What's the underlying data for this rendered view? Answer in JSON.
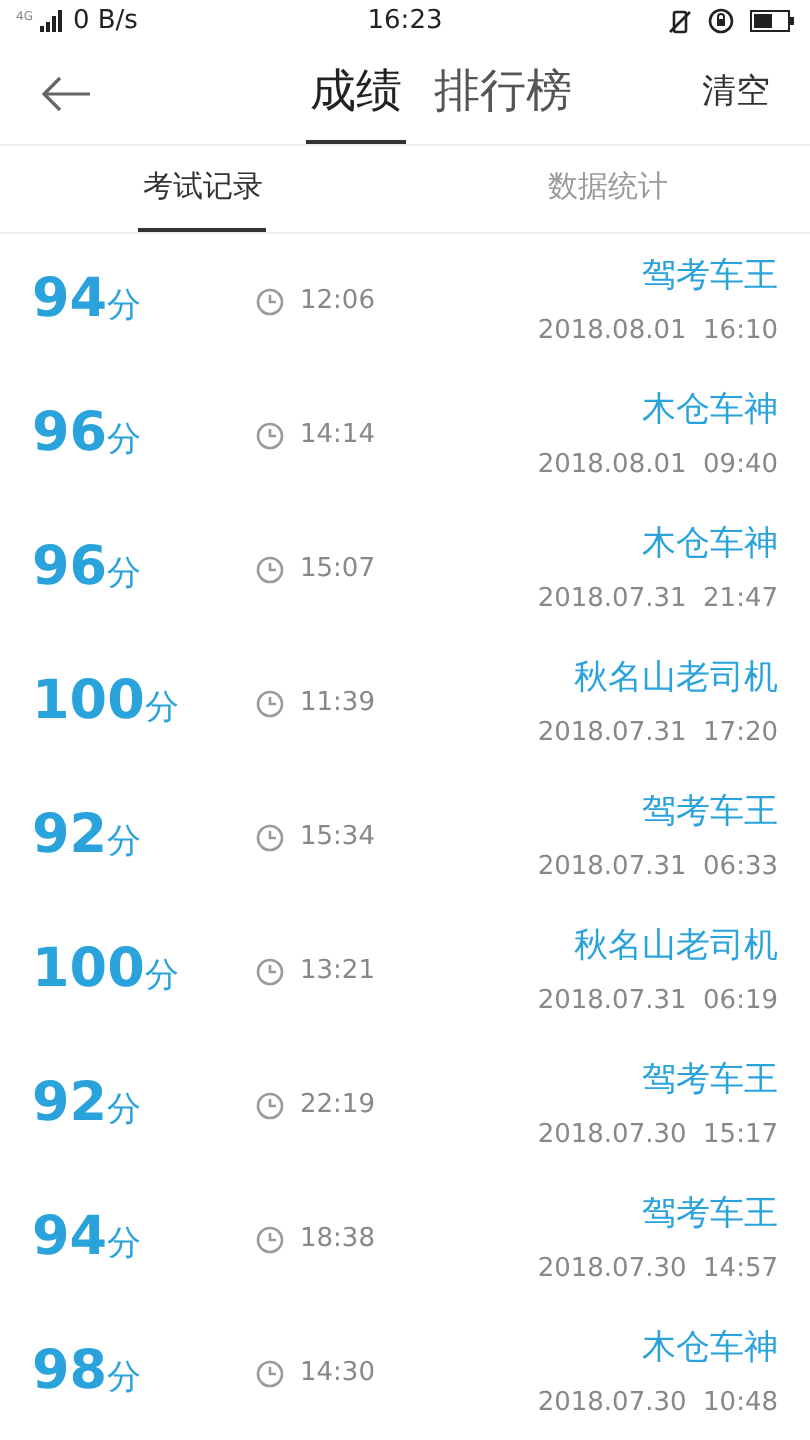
{
  "status_bar": {
    "signal": "4G",
    "speed": "0 B/s",
    "time": "16:23"
  },
  "header": {
    "tabs": [
      {
        "label": "成绩",
        "selected": true
      },
      {
        "label": "排行榜",
        "selected": false
      }
    ],
    "action": "清空"
  },
  "subtabs": [
    {
      "label": "考试记录",
      "selected": true
    },
    {
      "label": "数据统计",
      "selected": false
    }
  ],
  "records": [
    {
      "score": "94",
      "unit": "分",
      "duration": "12:06",
      "name": "驾考车王",
      "date": "2018.08.01  16:10"
    },
    {
      "score": "96",
      "unit": "分",
      "duration": "14:14",
      "name": "木仓车神",
      "date": "2018.08.01  09:40"
    },
    {
      "score": "96",
      "unit": "分",
      "duration": "15:07",
      "name": "木仓车神",
      "date": "2018.07.31  21:47"
    },
    {
      "score": "100",
      "unit": "分",
      "duration": "11:39",
      "name": "秋名山老司机",
      "date": "2018.07.31  17:20"
    },
    {
      "score": "92",
      "unit": "分",
      "duration": "15:34",
      "name": "驾考车王",
      "date": "2018.07.31  06:33"
    },
    {
      "score": "100",
      "unit": "分",
      "duration": "13:21",
      "name": "秋名山老司机",
      "date": "2018.07.31  06:19"
    },
    {
      "score": "92",
      "unit": "分",
      "duration": "22:19",
      "name": "驾考车王",
      "date": "2018.07.30  15:17"
    },
    {
      "score": "94",
      "unit": "分",
      "duration": "18:38",
      "name": "驾考车王",
      "date": "2018.07.30  14:57"
    },
    {
      "score": "98",
      "unit": "分",
      "duration": "14:30",
      "name": "木仓车神",
      "date": "2018.07.30  10:48"
    }
  ]
}
